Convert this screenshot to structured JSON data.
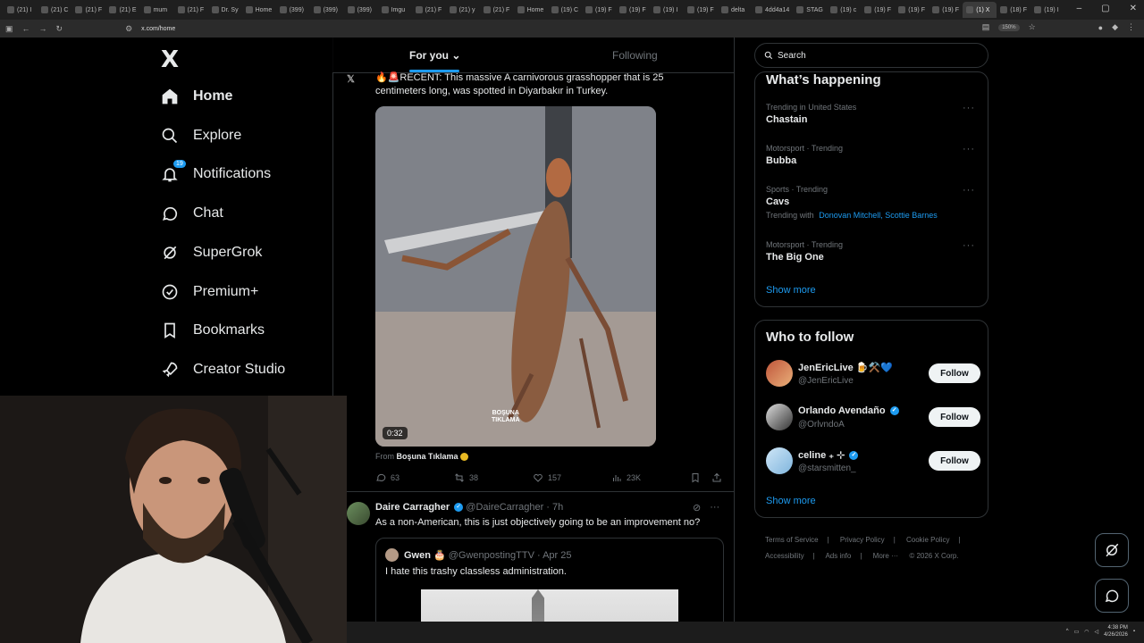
{
  "browser": {
    "tabs": [
      {
        "label": "(21) I"
      },
      {
        "label": "(21) C"
      },
      {
        "label": "(21) F"
      },
      {
        "label": "(21) E"
      },
      {
        "label": "mum"
      },
      {
        "label": "(21) F"
      },
      {
        "label": "Dr. Sy"
      },
      {
        "label": "Home"
      },
      {
        "label": "(399)"
      },
      {
        "label": "(399)"
      },
      {
        "label": "(399)"
      },
      {
        "label": "Imgu"
      },
      {
        "label": "(21) F"
      },
      {
        "label": "(21) y"
      },
      {
        "label": "(21) F"
      },
      {
        "label": "Home"
      },
      {
        "label": "(19) C"
      },
      {
        "label": "(19) F"
      },
      {
        "label": "(19) F"
      },
      {
        "label": "(19) I"
      },
      {
        "label": "(19) F"
      },
      {
        "label": "delta"
      },
      {
        "label": "4dd4a14"
      },
      {
        "label": "STAG"
      },
      {
        "label": "(19) c"
      },
      {
        "label": "(19) F"
      },
      {
        "label": "(19) F"
      },
      {
        "label": "(19) F"
      },
      {
        "label": "(1) X",
        "active": true
      },
      {
        "label": "(18) F"
      },
      {
        "label": "(19) I"
      }
    ],
    "url": "x.com/home",
    "zoom": "150%"
  },
  "nav": {
    "logo": "X",
    "items": [
      {
        "label": "Home",
        "icon": "home-icon"
      },
      {
        "label": "Explore",
        "icon": "search-icon"
      },
      {
        "label": "Notifications",
        "icon": "bell-icon",
        "badge": "19"
      },
      {
        "label": "Chat",
        "icon": "chat-icon"
      },
      {
        "label": "SuperGrok",
        "icon": "grok-icon"
      },
      {
        "label": "Premium+",
        "icon": "verified-icon"
      },
      {
        "label": "Bookmarks",
        "icon": "bookmark-icon"
      },
      {
        "label": "Creator Studio",
        "icon": "rocket-icon"
      }
    ]
  },
  "feed": {
    "tabs": [
      "For you",
      "Following"
    ],
    "post1": {
      "source_mark": "𝕏",
      "text": "🔥🚨RECENT: This massive A carnivorous grasshopper that is 25 centimeters long, was spotted in Diyarbakır in Turkey.",
      "video_duration": "0:32",
      "watermark_line1": "BOŞUNA",
      "watermark_line2": "TIKLAMA",
      "from_prefix": "From",
      "from_account": "Boşuna Tıklama",
      "stats": {
        "replies": "63",
        "reposts": "38",
        "likes": "157",
        "views": "23K"
      }
    },
    "post2": {
      "name": "Daire Carragher",
      "handle": "@DaireCarragher · 7h",
      "text": "As a non-American, this is just objectively going to be an improvement no?",
      "quote": {
        "name": "Gwen 🎂",
        "handle": "@GwenpostingTTV · Apr 25",
        "text": "I hate this trashy classless administration."
      }
    }
  },
  "sidebar": {
    "search_placeholder": "Search",
    "happening": {
      "title": "What’s happening",
      "trends": [
        {
          "meta": "Trending in United States",
          "name": "Chastain"
        },
        {
          "meta": "Motorsport · Trending",
          "name": "Bubba"
        },
        {
          "meta": "Sports · Trending",
          "name": "Cavs",
          "sub_prefix": "Trending with",
          "sub_links": "Donovan Mitchell, Scottie Barnes"
        },
        {
          "meta": "Motorsport · Trending",
          "name": "The Big One"
        }
      ],
      "show_more": "Show more"
    },
    "who_to_follow": {
      "title": "Who to follow",
      "accounts": [
        {
          "name": "JenEricLive 🍺⚒️💙",
          "handle": "@JenEricLive",
          "button": "Follow"
        },
        {
          "name": "Orlando Avendaño",
          "handle": "@OrlvndoA",
          "button": "Follow"
        },
        {
          "name": "celine ₊ ⊹",
          "handle": "@starsmitten_",
          "button": "Follow"
        }
      ],
      "show_more": "Show more"
    },
    "footer": [
      "Terms of Service",
      "|",
      "Privacy Policy",
      "|",
      "Cookie Policy",
      "|",
      "Accessibility",
      "|",
      "Ads info",
      "|",
      "More ···",
      "© 2026 X Corp."
    ]
  },
  "taskbar": {
    "time": "4:38 PM",
    "date": "4/26/2026"
  },
  "colors": {
    "accent": "#1d9bf0",
    "background": "#000000",
    "border": "#2f3336",
    "muted": "#71767b"
  }
}
